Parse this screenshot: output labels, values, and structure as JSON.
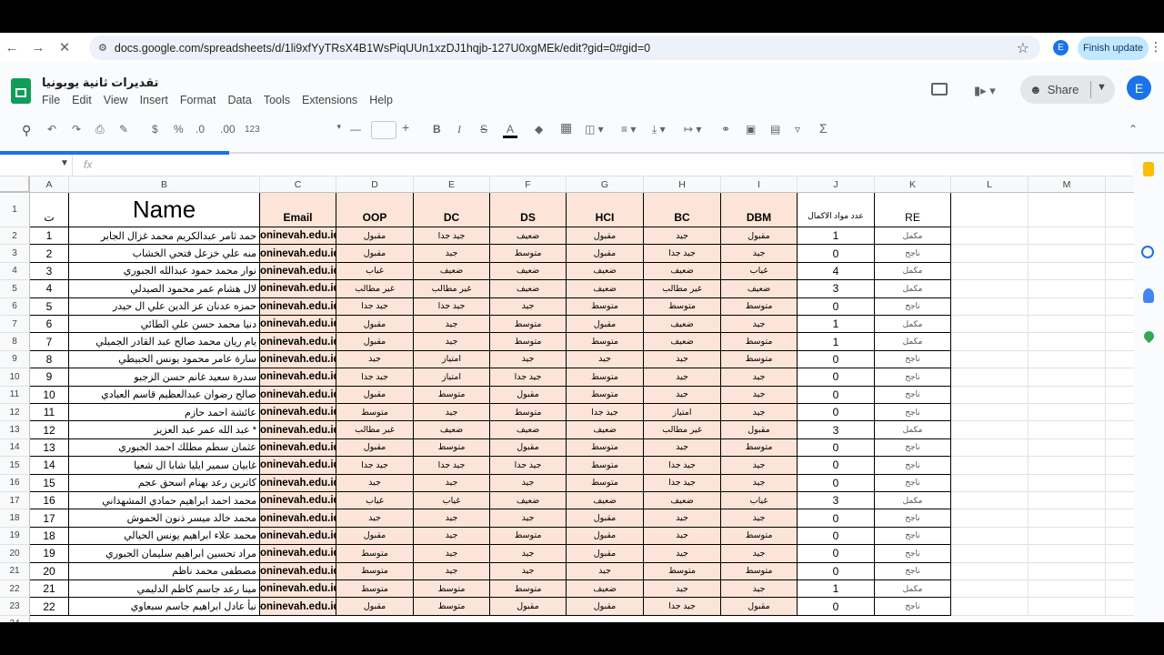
{
  "browser": {
    "url": "docs.google.com/spreadsheets/d/1li9xfYyTRsX4B1WsPiqUUn1xzDJ1hqjb-127U0xgMEk/edit?gid=0#gid=0",
    "profile_letter": "E",
    "finish_update_label": "Finish update"
  },
  "doc": {
    "title": "تقديرات ثانية يوبونيا",
    "menu": [
      "File",
      "Edit",
      "View",
      "Insert",
      "Format",
      "Data",
      "Tools",
      "Extensions",
      "Help"
    ],
    "share_label": "Share",
    "account_letter": "E"
  },
  "toolbar": {
    "currency": "$",
    "percent": "%",
    "dec_minus": ".0",
    "dec_plus": ".00",
    "num_format": "123",
    "font_minus": "—",
    "font_plus": "+"
  },
  "formula_bar": {
    "fx": "fx"
  },
  "columns": [
    "A",
    "B",
    "C",
    "D",
    "E",
    "F",
    "G",
    "H",
    "I",
    "J",
    "K",
    "L",
    "M",
    "N"
  ],
  "header_row": {
    "a": "ت",
    "b": "Name",
    "c": "Email",
    "d": "OOP",
    "e": "DC",
    "f": "DS",
    "g": "HCI",
    "h": "BC",
    "i": "DBM",
    "j": "عدد مواد الاكمال",
    "k": "RE"
  },
  "email_domain": "oninevah.edu.iq",
  "rows": [
    {
      "n": "1",
      "name": "حمد ثامر عبدالكريم محمد غزال الجابر",
      "oop": "مقبول",
      "dc": "جيد جدا",
      "ds": "ضعيف",
      "hci": "مقبول",
      "bc": "جيد",
      "dbm": "مقبول",
      "count": "1",
      "re": "مكمل"
    },
    {
      "n": "2",
      "name": "منه علي خزعل فتحي الخشاب",
      "oop": "مقبول",
      "dc": "جيد",
      "ds": "متوسط",
      "hci": "مقبول",
      "bc": "جيد جدا",
      "dbm": "جيد",
      "count": "0",
      "re": "ناجح"
    },
    {
      "n": "3",
      "name": "نوار محمد حمود عبدالله الجبوري",
      "oop": "غياب",
      "dc": "ضعيف",
      "ds": "ضعيف",
      "hci": "ضعيف",
      "bc": "ضعيف",
      "dbm": "غياب",
      "count": "4",
      "re": "مكمل"
    },
    {
      "n": "4",
      "name": "لال هشام عمر محمود الصيدلي",
      "oop": "غير مطالب",
      "dc": "غير مطالب",
      "ds": "ضعيف",
      "hci": "ضعيف",
      "bc": "غير مطالب",
      "dbm": "ضعيف",
      "count": "3",
      "re": "مكمل"
    },
    {
      "n": "5",
      "name": "حمزه عدنان عز الدين علي ال حيدر",
      "oop": "جيد جدا",
      "dc": "جيد جدا",
      "ds": "جيد",
      "hci": "متوسط",
      "bc": "متوسط",
      "dbm": "متوسط",
      "count": "0",
      "re": "ناجح"
    },
    {
      "n": "6",
      "name": "دنيا محمد حسن علي الطائي",
      "oop": "مقبول",
      "dc": "جيد",
      "ds": "متوسط",
      "hci": "مقبول",
      "bc": "ضعيف",
      "dbm": "جيد",
      "count": "1",
      "re": "مكمل"
    },
    {
      "n": "7",
      "name": "يام ريان محمد صالح عبد القادر الجميلي",
      "oop": "مقبول",
      "dc": "جيد",
      "ds": "متوسط",
      "hci": "متوسط",
      "bc": "ضعيف",
      "dbm": "متوسط",
      "count": "1",
      "re": "مكمل"
    },
    {
      "n": "8",
      "name": "سارة عامر محمود يونس الحبيطي",
      "oop": "جيد",
      "dc": "امتياز",
      "ds": "جيد",
      "hci": "جيد",
      "bc": "جيد",
      "dbm": "متوسط",
      "count": "0",
      "re": "ناجح"
    },
    {
      "n": "9",
      "name": "سدرة سعيد غانم حسن الزجبو",
      "oop": "جيد جدا",
      "dc": "امتياز",
      "ds": "جيد جدا",
      "hci": "متوسط",
      "bc": "جيد",
      "dbm": "جيد",
      "count": "0",
      "re": "ناجح"
    },
    {
      "n": "10",
      "name": "صالح رضوان عبدالعظيم قاسم العبادي",
      "oop": "مقبول",
      "dc": "متوسط",
      "ds": "مقبول",
      "hci": "متوسط",
      "bc": "جيد",
      "dbm": "جيد",
      "count": "0",
      "re": "ناجح"
    },
    {
      "n": "11",
      "name": "عائشة احمد حازم",
      "oop": "متوسط",
      "dc": "جيد",
      "ds": "متوسط",
      "hci": "جيد جدا",
      "bc": "امتياز",
      "dbm": "جيد",
      "count": "0",
      "re": "ناجح"
    },
    {
      "n": "12",
      "name": "عبد الله عمر عبد العزيز *",
      "oop": "غير مطالب",
      "dc": "ضعيف",
      "ds": "ضعيف",
      "hci": "ضعيف",
      "bc": "غير مطالب",
      "dbm": "مقبول",
      "count": "3",
      "re": "مكمل"
    },
    {
      "n": "13",
      "name": "عثمان سطم مطلك احمد الجبوري",
      "oop": "مقبول",
      "dc": "متوسط",
      "ds": "مقبول",
      "hci": "متوسط",
      "bc": "جيد",
      "dbm": "متوسط",
      "count": "0",
      "re": "ناجح"
    },
    {
      "n": "14",
      "name": "غابيان سمير ايليا شابا ال شعيا",
      "oop": "جيد جدا",
      "dc": "جيد جدا",
      "ds": "جيد جدا",
      "hci": "متوسط",
      "bc": "جيد جدا",
      "dbm": "جيد",
      "count": "0",
      "re": "ناجح"
    },
    {
      "n": "15",
      "name": "كاترين رعد بهنام اسحق عجم",
      "oop": "جيد",
      "dc": "جيد",
      "ds": "جيد",
      "hci": "متوسط",
      "bc": "جيد جدا",
      "dbm": "جيد",
      "count": "0",
      "re": "ناجح"
    },
    {
      "n": "16",
      "name": "محمد احمد ابراهيم حمادي المشهداني",
      "oop": "غياب",
      "dc": "غياب",
      "ds": "ضعيف",
      "hci": "ضعيف",
      "bc": "ضعيف",
      "dbm": "غياب",
      "count": "3",
      "re": "مكمل"
    },
    {
      "n": "17",
      "name": "محمد خالد ميسر ذنون الحموش",
      "oop": "جيد",
      "dc": "جيد",
      "ds": "جيد",
      "hci": "مقبول",
      "bc": "جيد",
      "dbm": "جيد",
      "count": "0",
      "re": "ناجح"
    },
    {
      "n": "18",
      "name": "محمد علاء ابراهيم يونس الحيالي",
      "oop": "مقبول",
      "dc": "جيد",
      "ds": "متوسط",
      "hci": "مقبول",
      "bc": "جيد",
      "dbm": "متوسط",
      "count": "0",
      "re": "ناجح"
    },
    {
      "n": "19",
      "name": "مراد تحسين ابراهيم سليمان الجبوري",
      "oop": "متوسط",
      "dc": "جيد",
      "ds": "جيد",
      "hci": "مقبول",
      "bc": "جيد",
      "dbm": "جيد",
      "count": "0",
      "re": "ناجح"
    },
    {
      "n": "20",
      "name": "مصطفى محمد ناظم",
      "oop": "متوسط",
      "dc": "جيد",
      "ds": "جيد",
      "hci": "جيد",
      "bc": "متوسط",
      "dbm": "متوسط",
      "count": "0",
      "re": "ناجح"
    },
    {
      "n": "21",
      "name": "مينا رعد جاسم كاظم الدليمي",
      "oop": "متوسط",
      "dc": "متوسط",
      "ds": "متوسط",
      "hci": "ضعيف",
      "bc": "جيد",
      "dbm": "جيد",
      "count": "1",
      "re": "مكمل"
    },
    {
      "n": "22",
      "name": "نبأ عادل ابراهيم جاسم سبعاوي",
      "oop": "مقبول",
      "dc": "متوسط",
      "ds": "مقبول",
      "hci": "مقبول",
      "bc": "جيد جدا",
      "dbm": "مقبول",
      "count": "0",
      "re": "ناجح"
    }
  ]
}
